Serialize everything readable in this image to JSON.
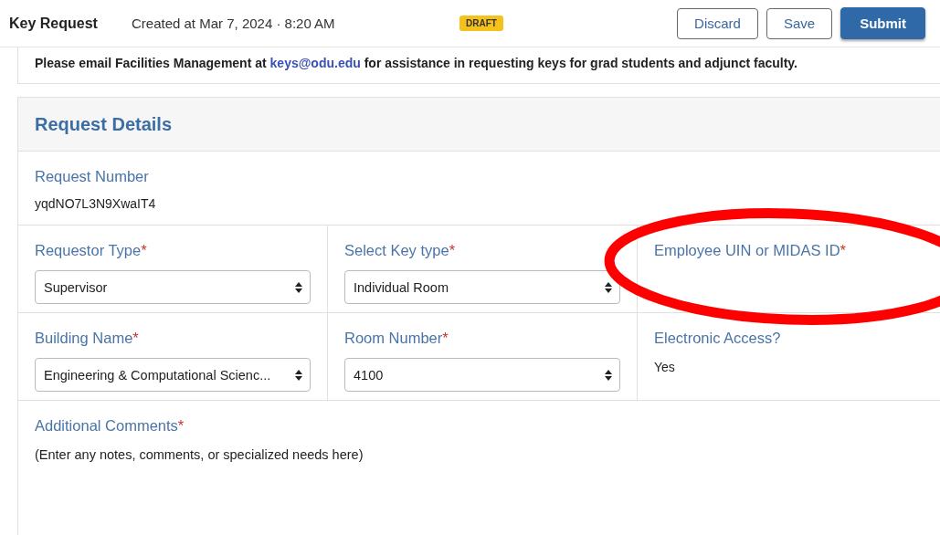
{
  "header": {
    "title": "Key Request",
    "created": "Created at Mar 7, 2024 · 8:20 AM",
    "status_badge": "DRAFT",
    "buttons": [
      {
        "label": "Discard",
        "kind": "outline"
      },
      {
        "label": "Save",
        "kind": "outline"
      },
      {
        "label": "Submit",
        "kind": "primary"
      }
    ]
  },
  "notice": {
    "before": "Please email Facilities Management at",
    "link": "keys@odu.edu",
    "after": "for assistance in requesting keys for grad students and adjunct faculty."
  },
  "panel": {
    "title": "Request Details",
    "request_number": {
      "label": "Request Number",
      "value": "yqdNO7L3N9XwaIT4"
    },
    "fields": [
      {
        "label": "Requestor Type",
        "required_mark": "*",
        "kind": "select",
        "value": "Supervisor"
      },
      {
        "label": "Select Key type",
        "required_mark": "*",
        "kind": "select",
        "value": "Individual Room"
      },
      {
        "label": "Employee UIN or MIDAS ID",
        "required_mark": "*",
        "kind": "empty"
      },
      {
        "label": "Building Name",
        "required_mark": "*",
        "kind": "select",
        "value": "Engineering & Computational Scienc..."
      },
      {
        "label": "Room Number",
        "required_mark": "*",
        "kind": "select",
        "value": "4100"
      },
      {
        "label": "Electronic Access?",
        "kind": "value",
        "value": "Yes"
      }
    ],
    "comments": {
      "label": "Additional Comments",
      "required_mark": "*",
      "placeholder": "(Enter any notes, comments, or specialized needs here)"
    }
  }
}
